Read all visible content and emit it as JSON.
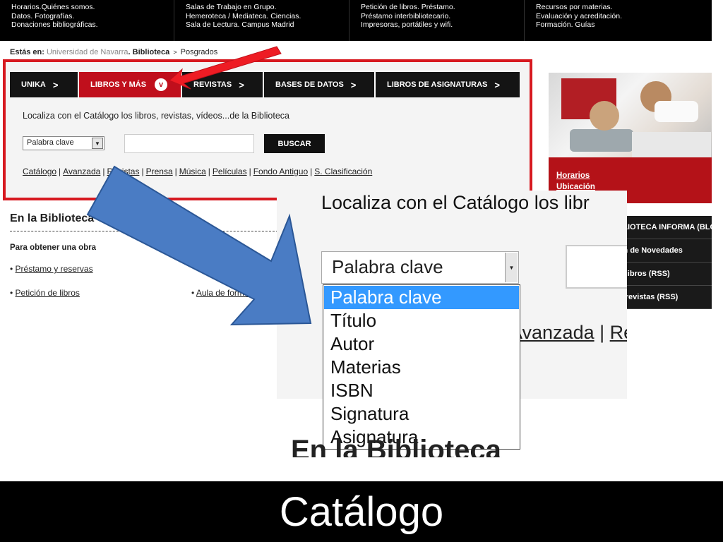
{
  "top_menu": {
    "columns": [
      [
        "Horarios.Quiénes somos.",
        "Datos. Fotografías.",
        "Donaciones bibliográficas."
      ],
      [
        "Salas de Trabajo en Grupo.",
        "Hemeroteca / Mediateca. Ciencias.",
        "Sala de Lectura. Campus Madrid"
      ],
      [
        "Petición de libros. Préstamo.",
        "Préstamo interbibliotecario.",
        "Impresoras, portátiles y wifi."
      ],
      [
        "Recursos por materias.",
        "Evaluación y acreditación.",
        "Formación. Guías"
      ]
    ]
  },
  "breadcrumb": {
    "label": "Estás en:",
    "items": [
      "Universidad de Navarra",
      "Biblioteca",
      "Posgrados"
    ]
  },
  "tabs": [
    {
      "label": "UNIKA",
      "chevron": ">"
    },
    {
      "label": "LIBROS Y MÁS",
      "chevron": "v"
    },
    {
      "label": "REVISTAS",
      "chevron": ">"
    },
    {
      "label": "BASES DE DATOS",
      "chevron": ">"
    },
    {
      "label": "LIBROS DE ASIGNATURAS",
      "chevron": ">"
    }
  ],
  "search": {
    "intro": "Localiza con el Catálogo los libros, revistas, vídeos...de la Biblioteca",
    "select_value": "Palabra clave",
    "input_value": "",
    "button_label": "BUSCAR",
    "links": [
      "Catálogo",
      "Avanzada",
      "Revistas",
      "Prensa",
      "Música",
      "Películas",
      "Fondo Antiguo",
      "S. Clasificación"
    ]
  },
  "right_panel": {
    "links": [
      "Horarios",
      "Ubicación"
    ],
    "menu": [
      "LA BIBLIOTECA INFORMA (BLOG)",
      "Boletín de Novedades",
      "Novedades libros (RSS)",
      "Novedades revistas (RSS)"
    ]
  },
  "section": {
    "title": "En la Biblioteca",
    "subtitle": "Para obtener una obra",
    "items": [
      "Préstamo y reservas",
      "Petición de libros",
      "Aula de formación"
    ]
  },
  "zoom": {
    "intro": "Localiza con el Catálogo los libr",
    "select_value": "Palabra clave",
    "links": [
      "Avanzada",
      "Revistas"
    ],
    "options": [
      "Palabra clave",
      "Título",
      "Autor",
      "Materias",
      "ISBN",
      "Signatura",
      "Asignatura"
    ],
    "selected_option": "Palabra clave",
    "footer_title": "En la Biblioteca"
  },
  "caption": "Catálogo",
  "colors": {
    "brand_red": "#c00f1c",
    "highlight_red": "#d71920",
    "arrow_blue": "#4a7cc4",
    "option_selected": "#3399ff"
  }
}
